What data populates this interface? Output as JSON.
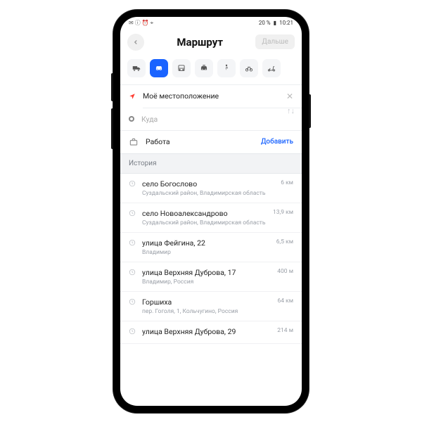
{
  "status": {
    "left_icons": "✉ ⓘ ⏰ ⌖",
    "right": "20 %",
    "time": "10:21"
  },
  "header": {
    "title": "Маршрут",
    "next": "Дальше"
  },
  "transport_modes": [
    {
      "name": "truck"
    },
    {
      "name": "car",
      "active": true
    },
    {
      "name": "bus"
    },
    {
      "name": "taxi"
    },
    {
      "name": "walk"
    },
    {
      "name": "bike"
    },
    {
      "name": "scooter"
    }
  ],
  "from": {
    "label": "Моё местоположение"
  },
  "to": {
    "placeholder": "Куда"
  },
  "saved": {
    "label": "Работа",
    "action": "Добавить"
  },
  "history_header": "История",
  "history": [
    {
      "title": "село Богослово",
      "sub": "Суздальский район, Владимирская область",
      "dist": "6 км"
    },
    {
      "title": "село Новоалександрово",
      "sub": "Суздальский район, Владимирская область",
      "dist": "13,9 км"
    },
    {
      "title": "улица Фейгина, 22",
      "sub": "Владимир",
      "dist": "6,5 км"
    },
    {
      "title": "улица Верхняя Дуброва, 17",
      "sub": "Владимир, Россия",
      "dist": "400 м"
    },
    {
      "title": "Горшиха",
      "sub": "пер. Гоголя, 1, Кольчугино, Россия",
      "dist": "64 км"
    },
    {
      "title": "улица Верхняя Дуброва, 29",
      "sub": "",
      "dist": "214 м"
    }
  ]
}
